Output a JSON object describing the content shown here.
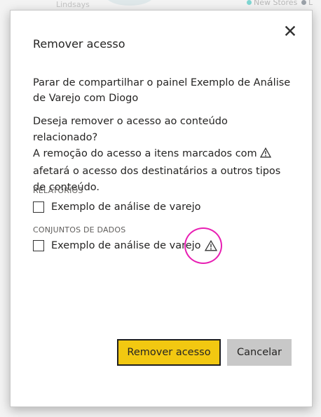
{
  "background": {
    "text_left": "Lindsays",
    "legend": [
      "New Stores",
      "L"
    ],
    "colors": {
      "teal": "#7fd6d2",
      "gray": "#9aa1a8"
    }
  },
  "dialog": {
    "title": "Remover acesso",
    "close_icon": "close-icon",
    "intro": "Parar de compartilhar o painel Exemplo de Análise de Varejo com Diogo",
    "question": "Deseja remover o acesso ao conteúdo relacionado?",
    "note_before_icon": "A remoção do acesso a itens marcados com",
    "note_after_icon": "afetará o acesso dos destinatários a outros tipos de conteúdo.",
    "sections": [
      {
        "label": "RELATÓRIOS",
        "items": [
          {
            "label": "Exemplo de análise de varejo",
            "checked": false,
            "warning": false
          }
        ]
      },
      {
        "label": "CONJUNTOS DE DADOS",
        "items": [
          {
            "label": "Exemplo de análise de varejo",
            "checked": false,
            "warning": true
          }
        ]
      }
    ],
    "buttons": {
      "primary": "Remover acesso",
      "secondary": "Cancelar"
    },
    "colors": {
      "primary_button": "#f2c811",
      "secondary_button": "#c8c8c8",
      "highlight_ring": "#e81fb3"
    }
  }
}
